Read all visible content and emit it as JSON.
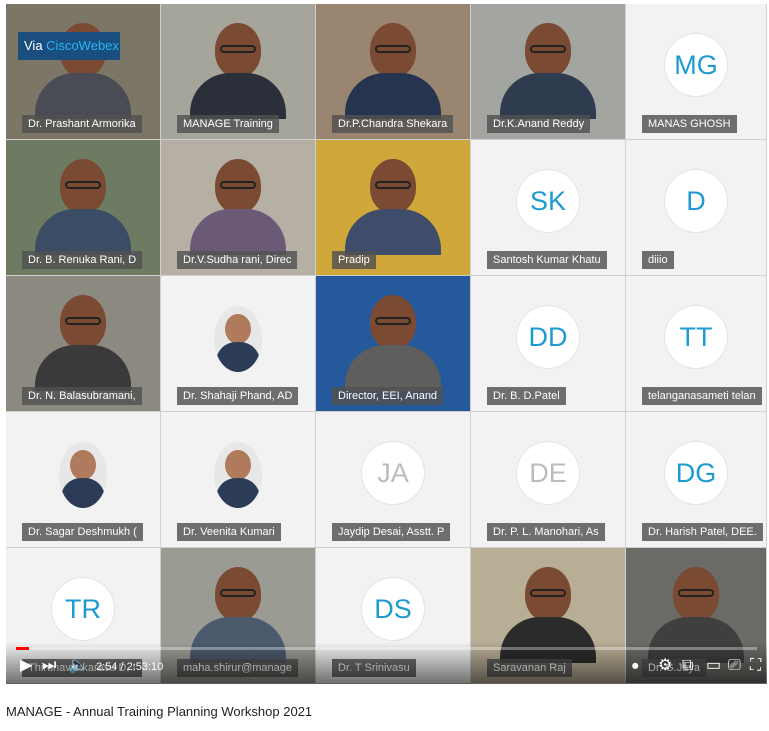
{
  "branding": {
    "webex_prefix": "Via ",
    "webex_brand": "CiscoWebex"
  },
  "tiles": [
    {
      "name": "Dr. Prashant Armorika",
      "type": "video",
      "bg": "#7c7666",
      "shirt": "#4a4c55"
    },
    {
      "name": "MANAGE Training",
      "type": "video",
      "bg": "#a6a59c",
      "shirt": "#2a2f3a"
    },
    {
      "name": "Dr.P.Chandra Shekara",
      "type": "video",
      "bg": "#9a8670",
      "shirt": "#25344f"
    },
    {
      "name": "Dr.K.Anand Reddy",
      "type": "video",
      "bg": "#a3a5a1",
      "shirt": "#2f3b4f"
    },
    {
      "name": "MANAS GHOSH",
      "type": "avatar",
      "initials": "MG"
    },
    {
      "name": "Dr. B. Renuka Rani, D",
      "type": "video",
      "bg": "#6d7b63",
      "shirt": "#3a4d64"
    },
    {
      "name": "Dr.V.Sudha rani, Direc",
      "type": "video",
      "bg": "#b6b0a4",
      "shirt": "#6a5a78"
    },
    {
      "name": "Pradip",
      "type": "video",
      "bg": "#d0a73b",
      "shirt": "#3e4e6a"
    },
    {
      "name": "Santosh Kumar Khatu",
      "type": "avatar",
      "initials": "SK"
    },
    {
      "name": "diiio",
      "type": "avatar",
      "initials": "D"
    },
    {
      "name": "Dr. N. Balasubramani,",
      "type": "video",
      "bg": "#8c8a80",
      "shirt": "#3a3a3a"
    },
    {
      "name": "Dr. Shahaji Phand, AD",
      "type": "photo"
    },
    {
      "name": "Director, EEI, Anand",
      "type": "video",
      "bg": "#245a9c",
      "shirt": "#5e5e5e"
    },
    {
      "name": "Dr. B. D.Patel",
      "type": "avatar",
      "initials": "DD"
    },
    {
      "name": "telanganasameti telan",
      "type": "avatar",
      "initials": "TT"
    },
    {
      "name": "Dr. Sagar Deshmukh (",
      "type": "photo"
    },
    {
      "name": "Dr. Veenita Kumari",
      "type": "photo"
    },
    {
      "name": "Jaydip Desai, Asstt. P",
      "type": "avatar-grey",
      "initials": "JA"
    },
    {
      "name": "Dr. P. L. Manohari, As",
      "type": "avatar-grey",
      "initials": "DE"
    },
    {
      "name": "Dr. Harish Patel, DEE.",
      "type": "avatar",
      "initials": "DG"
    },
    {
      "name": "Thirunavukkarasu D, I",
      "type": "avatar",
      "initials": "TR"
    },
    {
      "name": "maha.shirur@manage",
      "type": "video",
      "bg": "#9a9c94",
      "shirt": "#4c5a6e"
    },
    {
      "name": "Dr. T Srinivasu",
      "type": "avatar",
      "initials": "DS"
    },
    {
      "name": "Saravanan Raj",
      "type": "video",
      "bg": "#b8ad95",
      "shirt": "#2b2b2b"
    },
    {
      "name": "Dr. G.Jaya",
      "type": "video",
      "bg": "#6a6a66",
      "shirt": "#3f3f3f"
    }
  ],
  "player": {
    "time_display": "2:54 / 2:53:10",
    "progress_fraction": 0.017,
    "progress_color": "#ff0000"
  },
  "video_title": "MANAGE - Annual Training Planning Workshop 2021"
}
